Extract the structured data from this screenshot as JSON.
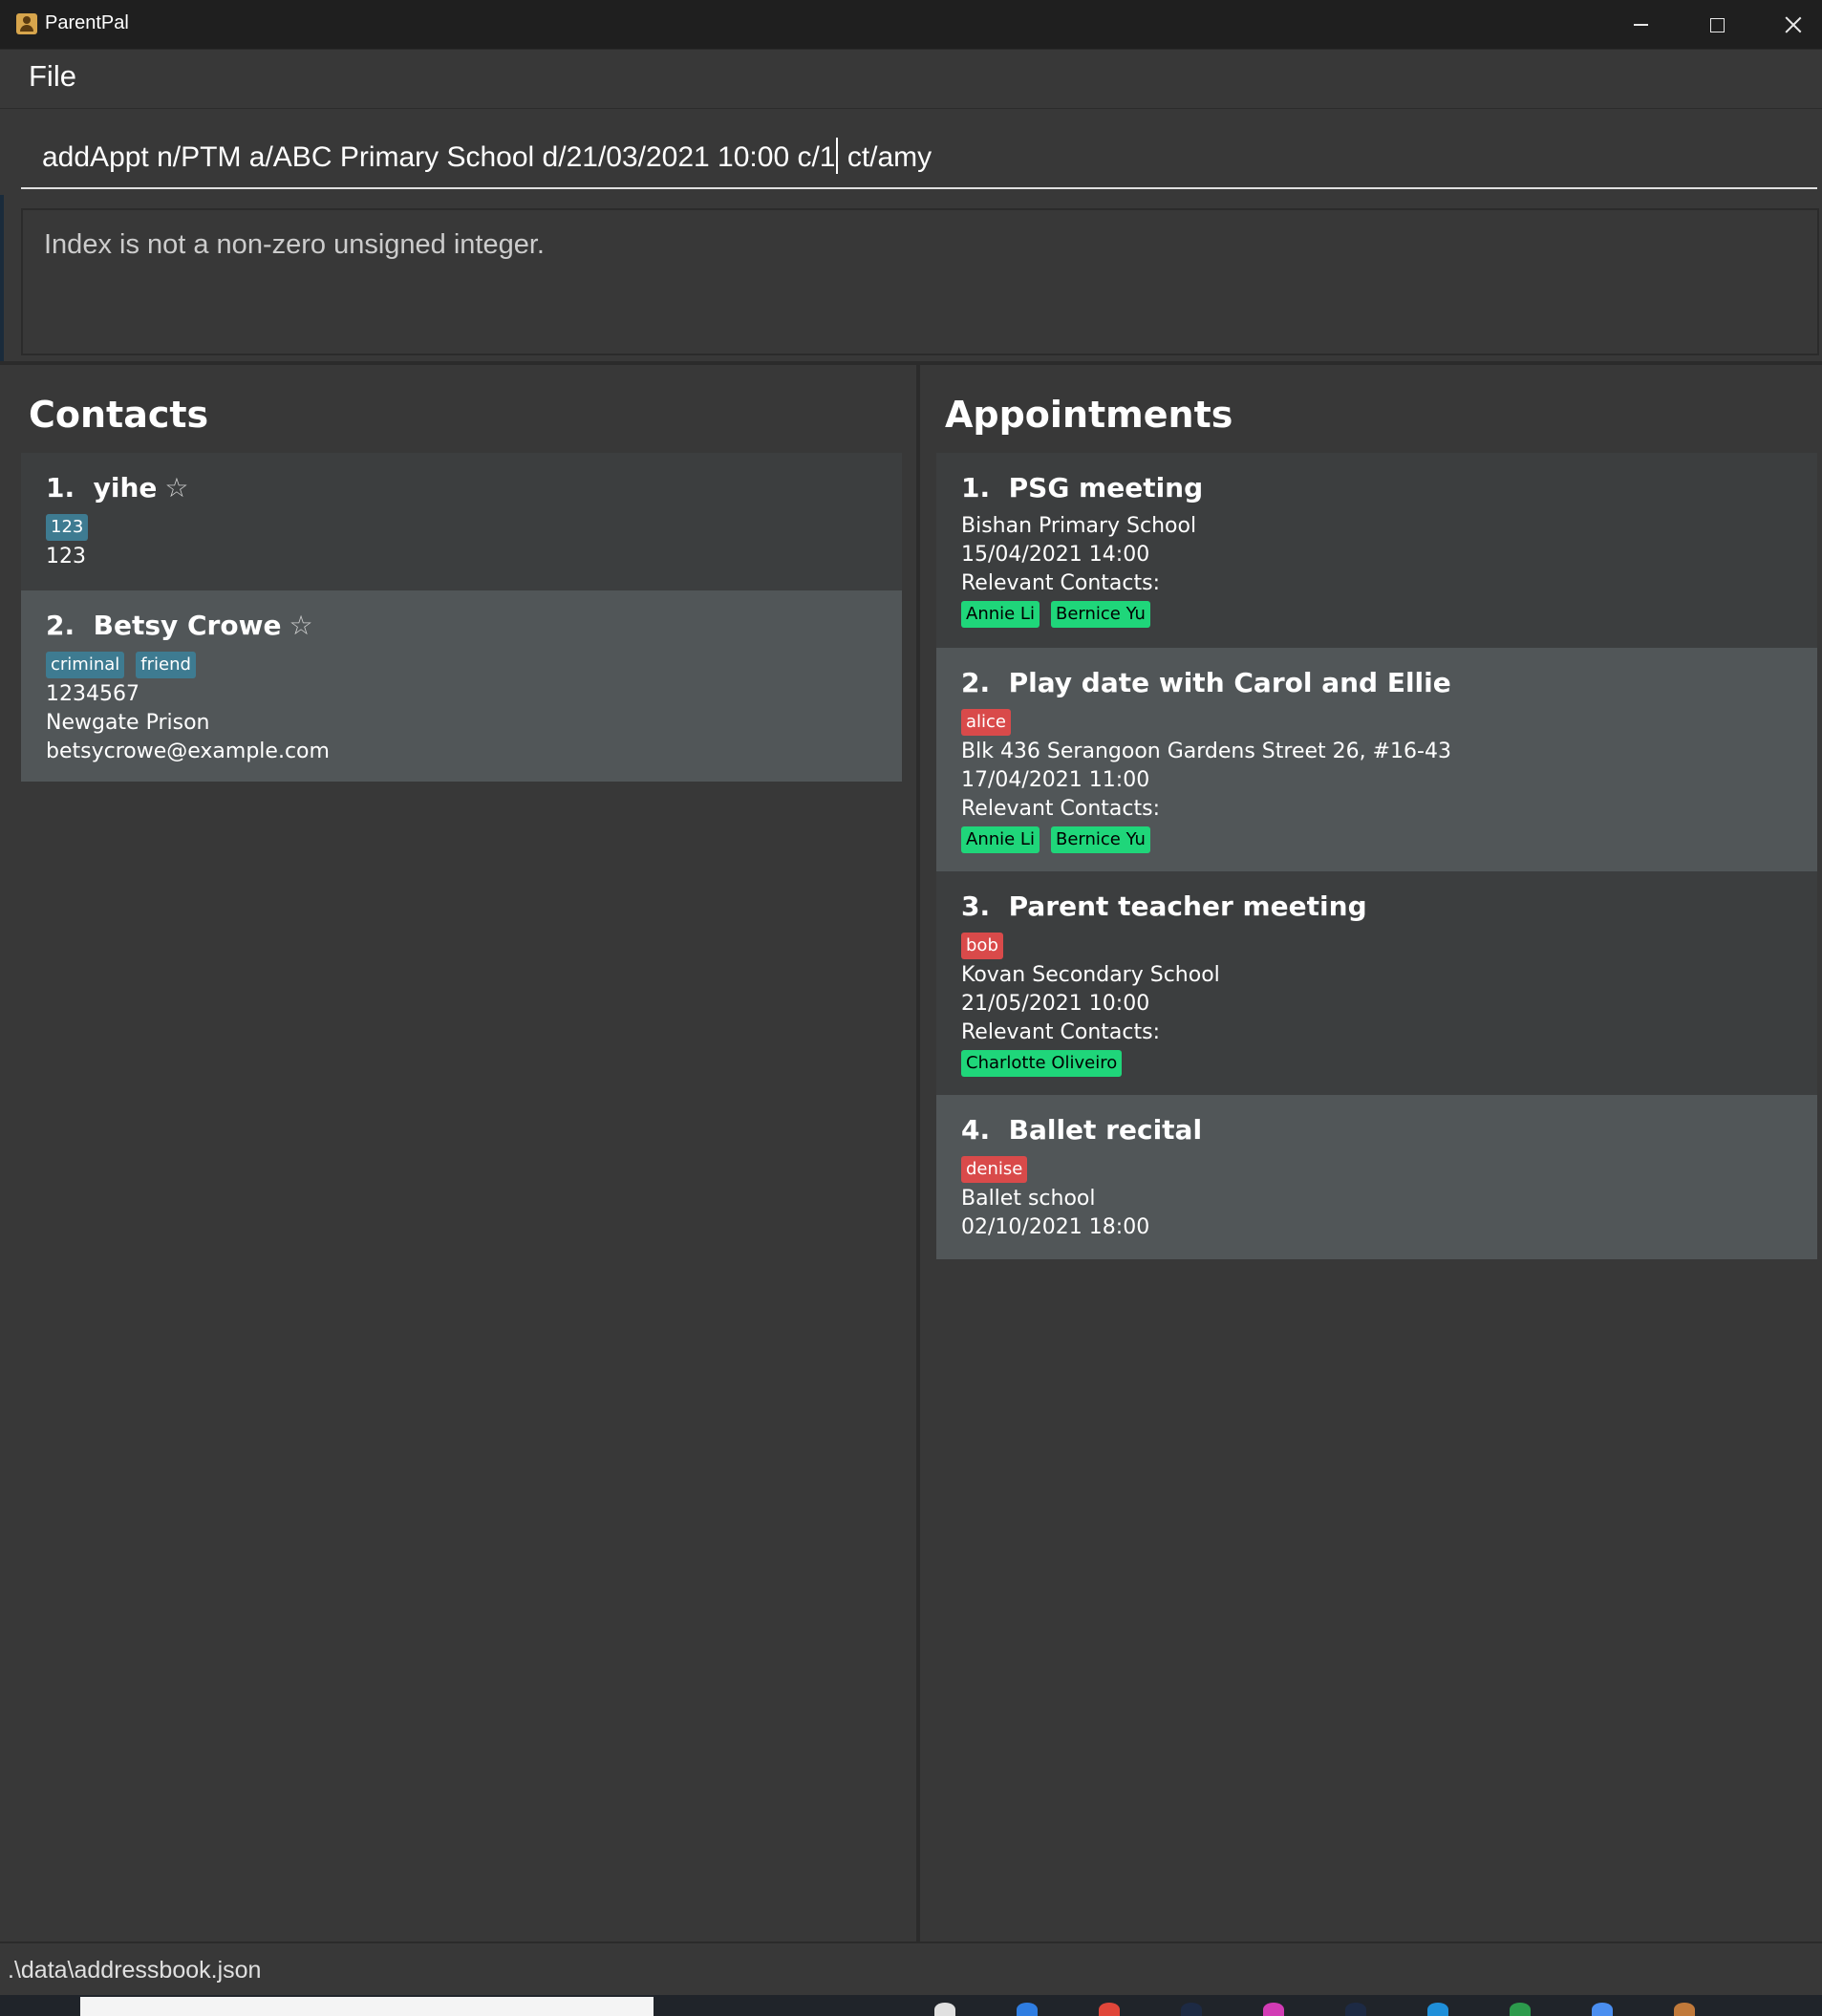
{
  "window": {
    "title": "ParentPal",
    "icon": "contact-book-icon"
  },
  "menu": {
    "file": "File"
  },
  "command": {
    "before_cursor": "addAppt n/PTM a/ABC Primary School d/21/03/2021 10:00 c/1",
    "after_cursor": " ct/amy"
  },
  "result": {
    "message": "Index is not a non-zero unsigned integer."
  },
  "contacts": {
    "title": "Contacts",
    "items": [
      {
        "index": "1.",
        "name": "yihe",
        "favourite_icon": "star-outline-icon",
        "tags": [
          "123"
        ],
        "phone": "123"
      },
      {
        "index": "2.",
        "name": "Betsy Crowe",
        "favourite_icon": "star-outline-icon",
        "tags": [
          "criminal",
          "friend"
        ],
        "phone": "1234567",
        "address": "Newgate Prison",
        "email": "betsycrowe@example.com"
      }
    ]
  },
  "appointments": {
    "title": "Appointments",
    "items": [
      {
        "index": "1.",
        "name": "PSG meeting",
        "address": "Bishan Primary School",
        "datetime": "15/04/2021 14:00",
        "contacts_label": "Relevant Contacts:",
        "contacts": [
          "Annie Li",
          "Bernice Yu"
        ]
      },
      {
        "index": "2.",
        "name": "Play date with Carol and Ellie",
        "tags": [
          "alice"
        ],
        "address": "Blk 436 Serangoon Gardens Street 26, #16-43",
        "datetime": "17/04/2021 11:00",
        "contacts_label": "Relevant Contacts:",
        "contacts": [
          "Annie Li",
          "Bernice Yu"
        ]
      },
      {
        "index": "3.",
        "name": "Parent teacher meeting",
        "tags": [
          "bob"
        ],
        "address": "Kovan Secondary School",
        "datetime": "21/05/2021 10:00",
        "contacts_label": "Relevant Contacts:",
        "contacts": [
          "Charlotte Oliveiro"
        ]
      },
      {
        "index": "4.",
        "name": "Ballet recital",
        "tags": [
          "denise"
        ],
        "address": "Ballet school",
        "datetime": "02/10/2021 18:00"
      }
    ]
  },
  "status": {
    "file_path": ".\\data\\addressbook.json"
  },
  "colors": {
    "background": "#383838",
    "card_dark": "#3c3e3f",
    "card_light": "#515658",
    "tag_blue": "#3e7b91",
    "tag_red": "#d94a4a",
    "tag_green": "#1fd67a"
  }
}
